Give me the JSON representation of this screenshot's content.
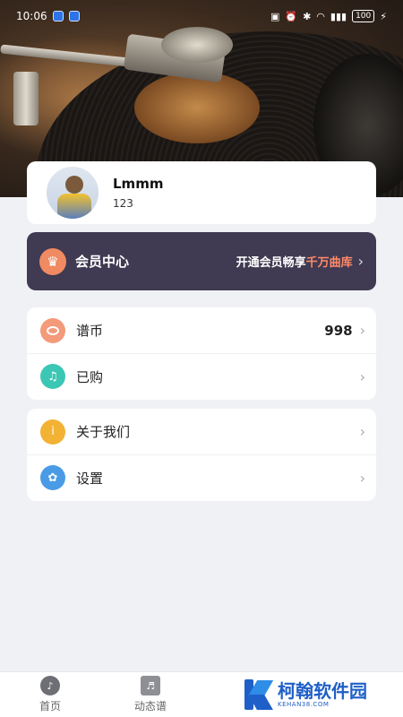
{
  "status_bar": {
    "time": "10:06",
    "battery": "100"
  },
  "profile": {
    "name": "Lmmm",
    "id": "123"
  },
  "vip": {
    "title": "会员中心",
    "promo_prefix": "开通会员畅享",
    "promo_highlight": "千万曲库",
    "chevron": "›"
  },
  "menu_group_1": [
    {
      "label": "谱币",
      "value": "998",
      "icon": "coin-icon",
      "color": "#f39a7a"
    },
    {
      "label": "已购",
      "value": "",
      "icon": "music-note-icon",
      "color": "#3cc7b5"
    }
  ],
  "menu_group_2": [
    {
      "label": "关于我们",
      "icon": "info-icon",
      "color": "#f2b233"
    },
    {
      "label": "设置",
      "icon": "gear-icon",
      "color": "#4a9be6"
    }
  ],
  "bottom_nav": [
    {
      "label": "首页",
      "icon": "music-disc-icon"
    },
    {
      "label": "动态谱",
      "icon": "sheet-music-icon"
    }
  ],
  "watermark": {
    "cn": "柯翰软件园",
    "en": "KEHAN38.COM"
  },
  "colors": {
    "page_bg": "#eff1f5",
    "vip_bg": "#403a52",
    "vip_highlight": "#ff8a6a",
    "brand_blue": "#1f5fc8"
  }
}
